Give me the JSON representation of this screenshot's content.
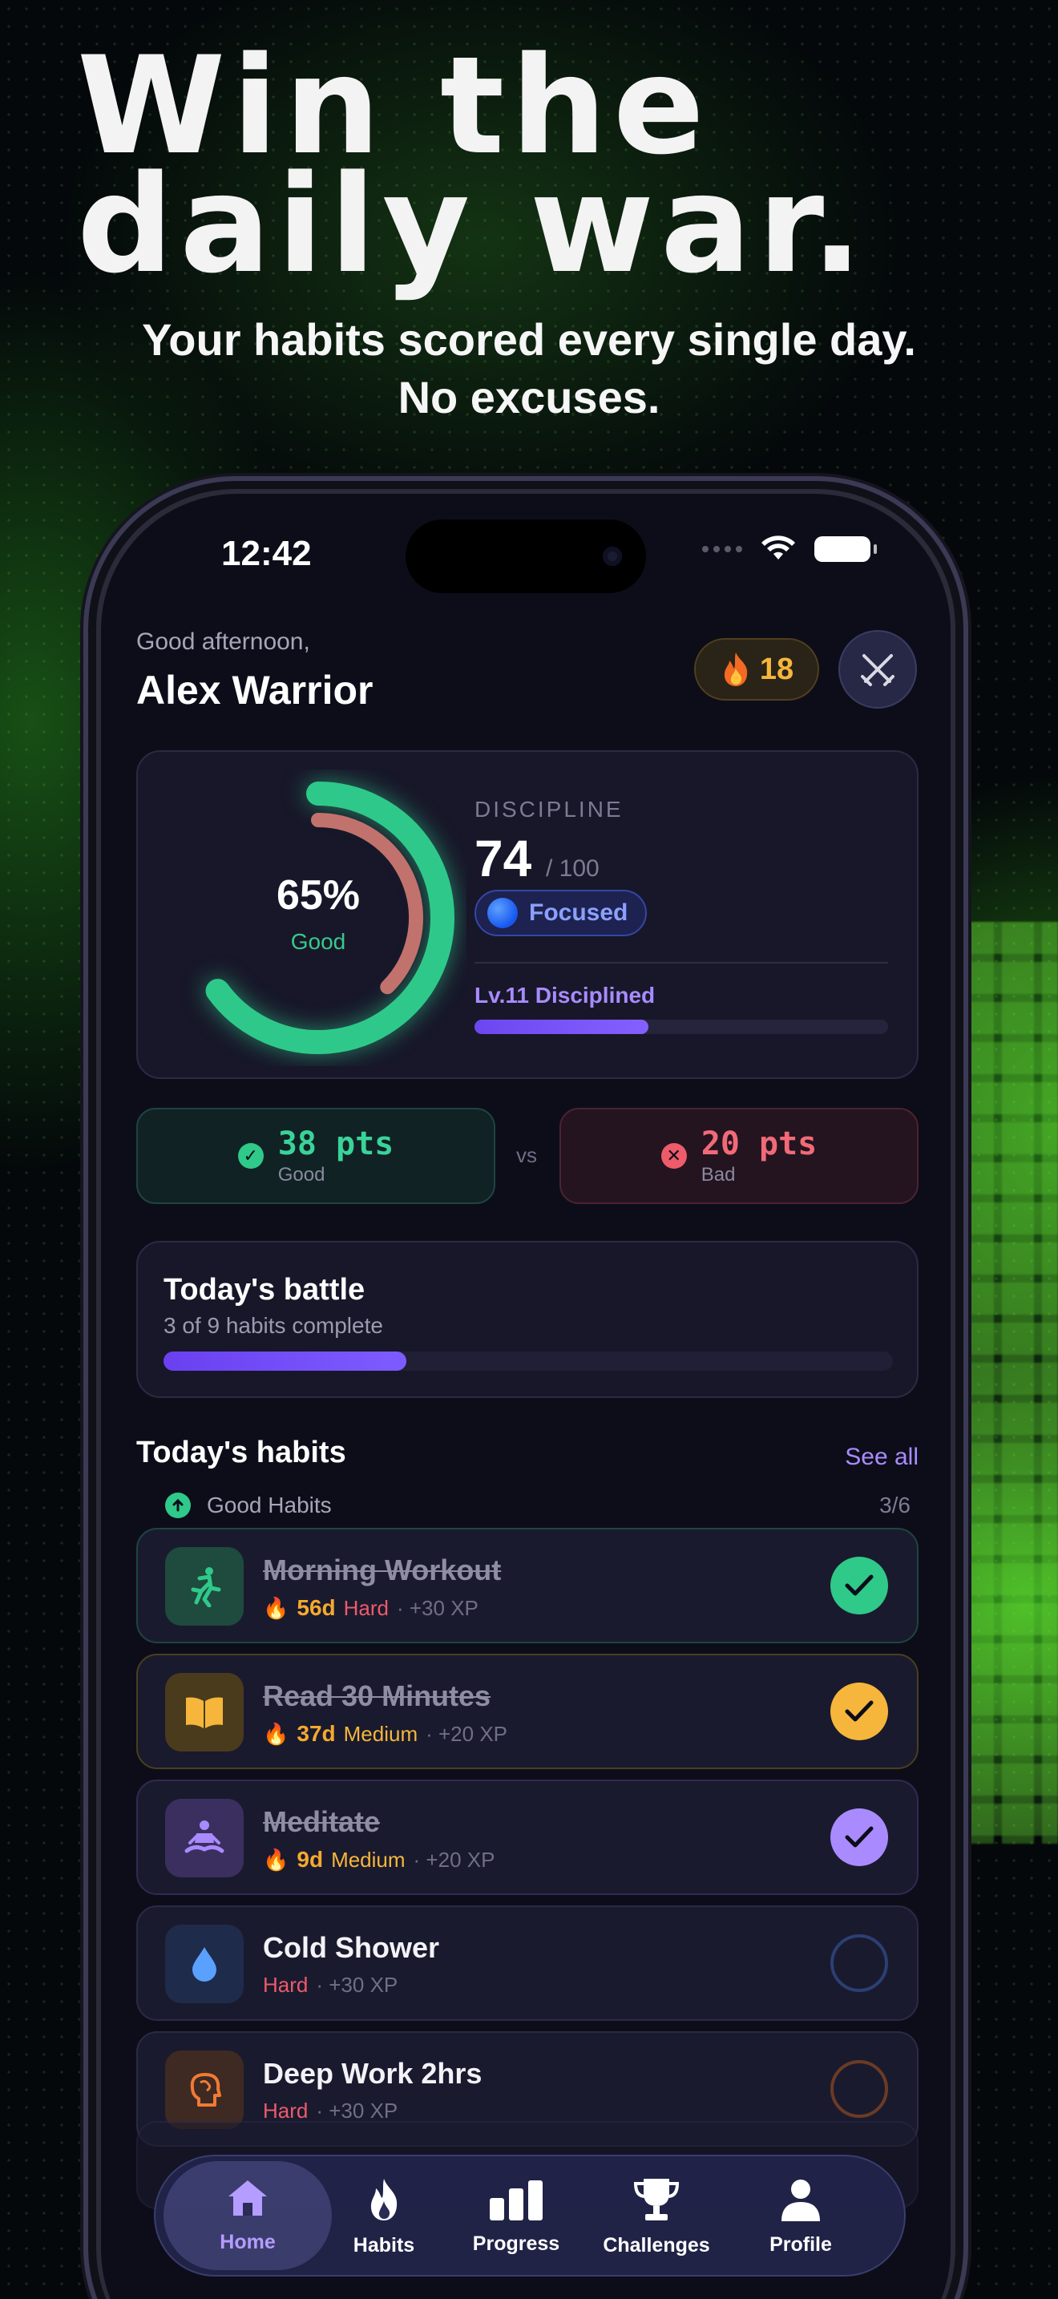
{
  "marketing": {
    "headline_line1": "Win the",
    "headline_line2": "daily war.",
    "sub_line1": "Your habits scored every single day.",
    "sub_line2": "No excuses."
  },
  "status_bar": {
    "time": "12:42"
  },
  "header": {
    "greeting": "Good afternoon,",
    "name": "Alex Warrior",
    "streak": "18",
    "streak_icon": "fire-icon",
    "action_icon": "crossed-swords-icon"
  },
  "discipline": {
    "ring_percent": "65%",
    "ring_label": "Good",
    "ring_value": 0.65,
    "label": "DISCIPLINE",
    "score": "74",
    "max": "/ 100",
    "state": "Focused",
    "level": "Lv.11 Disciplined",
    "level_progress": 0.42
  },
  "points": {
    "good_value": "38 pts",
    "good_label": "Good",
    "vs": "vs",
    "bad_value": "20 pts",
    "bad_label": "Bad"
  },
  "battle": {
    "title": "Today's battle",
    "subtitle": "3 of 9 habits complete",
    "progress": 0.3333
  },
  "habits_section": {
    "title": "Today's habits",
    "see_all": "See all",
    "group_label": "Good Habits",
    "group_count": "3/6"
  },
  "habits": [
    {
      "name": "Morning Workout",
      "streak": "56d",
      "difficulty": "Hard",
      "xp": "· +30 XP",
      "done": true,
      "icon": "running-icon",
      "color": "#2fc98a"
    },
    {
      "name": "Read 30 Minutes",
      "streak": "37d",
      "difficulty": "Medium",
      "xp": "· +20 XP",
      "done": true,
      "icon": "book-icon",
      "color": "#f5b63b"
    },
    {
      "name": "Meditate",
      "streak": "9d",
      "difficulty": "Medium",
      "xp": "· +20 XP",
      "done": true,
      "icon": "meditate-icon",
      "color": "#a98bff"
    },
    {
      "name": "Cold Shower",
      "streak": "",
      "difficulty": "Hard",
      "xp": "· +30 XP",
      "done": false,
      "icon": "water-drop-icon",
      "color": "#5aa0ff"
    },
    {
      "name": "Deep Work 2hrs",
      "streak": "",
      "difficulty": "Hard",
      "xp": "· +30 XP",
      "done": false,
      "icon": "brain-icon",
      "color": "#f07a35"
    }
  ],
  "tabbar": {
    "items": [
      {
        "label": "Home",
        "icon": "home-icon",
        "active": true
      },
      {
        "label": "Habits",
        "icon": "flame-icon",
        "active": false
      },
      {
        "label": "Progress",
        "icon": "bar-chart-icon",
        "active": false
      },
      {
        "label": "Challenges",
        "icon": "trophy-icon",
        "active": false
      },
      {
        "label": "Profile",
        "icon": "person-icon",
        "active": false
      }
    ]
  }
}
